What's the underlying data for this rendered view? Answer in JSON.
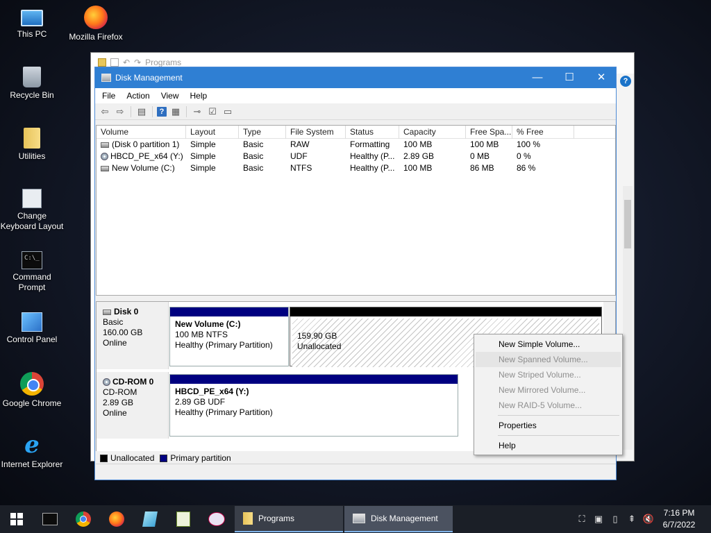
{
  "desktop": {
    "icons": [
      {
        "label": "This PC",
        "icon": "computer-icon"
      },
      {
        "label": "Mozilla Firefox",
        "icon": "firefox-icon"
      },
      {
        "label": "Recycle Bin",
        "icon": "recycle-bin-icon"
      },
      {
        "label": "Utilities",
        "icon": "folder-icon"
      },
      {
        "label": "Change Keyboard Layout",
        "icon": "keyboard-layout-icon"
      },
      {
        "label": "Command Prompt",
        "icon": "command-prompt-icon"
      },
      {
        "label": "Control Panel",
        "icon": "control-panel-icon"
      },
      {
        "label": "Google Chrome",
        "icon": "chrome-icon"
      },
      {
        "label": "Internet Explorer",
        "icon": "internet-explorer-icon"
      }
    ]
  },
  "background_window": {
    "title": "Programs",
    "help_glyph": "?"
  },
  "window": {
    "title": "Disk Management",
    "controls": {
      "minimize": "—",
      "maximize": "☐",
      "close": "✕"
    },
    "menu": [
      "File",
      "Action",
      "View",
      "Help"
    ],
    "toolbar": {
      "back": "⇦",
      "forward": "⇨",
      "help": "?"
    }
  },
  "volume_list": {
    "columns": [
      "Volume",
      "Layout",
      "Type",
      "File System",
      "Status",
      "Capacity",
      "Free Spa...",
      "% Free"
    ],
    "rows": [
      {
        "volume": "(Disk 0 partition 1)",
        "layout": "Simple",
        "type": "Basic",
        "fs": "RAW",
        "status": "Formatting",
        "capacity": "100 MB",
        "free": "100 MB",
        "pct": "100 %",
        "icon": "volume-icon"
      },
      {
        "volume": "HBCD_PE_x64 (Y:)",
        "layout": "Simple",
        "type": "Basic",
        "fs": "UDF",
        "status": "Healthy (P...",
        "capacity": "2.89 GB",
        "free": "0 MB",
        "pct": "0 %",
        "icon": "cdrom-icon"
      },
      {
        "volume": "New Volume (C:)",
        "layout": "Simple",
        "type": "Basic",
        "fs": "NTFS",
        "status": "Healthy (P...",
        "capacity": "100 MB",
        "free": "86 MB",
        "pct": "86 %",
        "icon": "volume-icon"
      }
    ]
  },
  "disks": [
    {
      "name": "Disk 0",
      "type": "Basic",
      "size": "160.00 GB",
      "state": "Online",
      "partitions": [
        {
          "name": "New Volume  (C:)",
          "line1": "100 MB NTFS",
          "line2": "Healthy (Primary Partition)"
        },
        {
          "name": "",
          "line1": "159.90 GB",
          "line2": "Unallocated"
        }
      ]
    },
    {
      "name": "CD-ROM 0",
      "type": "CD-ROM",
      "size": "2.89 GB",
      "state": "Online",
      "partitions": [
        {
          "name": "HBCD_PE_x64  (Y:)",
          "line1": "2.89 GB UDF",
          "line2": "Healthy (Primary Partition)"
        }
      ]
    }
  ],
  "legend": [
    {
      "label": "Unallocated",
      "color": "#000000"
    },
    {
      "label": "Primary partition",
      "color": "#000080"
    }
  ],
  "context_menu": {
    "items": [
      {
        "label": "New Simple Volume...",
        "enabled": true
      },
      {
        "label": "New Spanned Volume...",
        "enabled": false
      },
      {
        "label": "New Striped Volume...",
        "enabled": false
      },
      {
        "label": "New Mirrored Volume...",
        "enabled": false
      },
      {
        "label": "New RAID-5 Volume...",
        "enabled": false
      },
      {
        "label": "Properties",
        "enabled": true
      },
      {
        "label": "Help",
        "enabled": true
      }
    ]
  },
  "taskbar": {
    "tasks": [
      {
        "label": "Programs"
      },
      {
        "label": "Disk Management"
      }
    ],
    "clock": {
      "time": "7:16 PM",
      "date": "6/7/2022"
    }
  },
  "colors": {
    "title_bar": "#2f7fd3",
    "primary_partition": "#000080",
    "unallocated": "#000000",
    "taskbar": "#1b1f27"
  }
}
